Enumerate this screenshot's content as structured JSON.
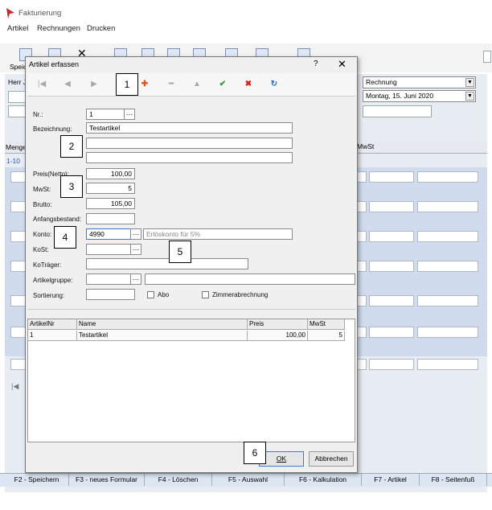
{
  "app": {
    "title": "Fakturierung"
  },
  "menu": [
    "Artikel",
    "Rechnungen",
    "Drucken"
  ],
  "toolbar": {
    "save_partial": "Speic"
  },
  "background": {
    "customer_partial": "Herr J",
    "invoice_type": "Rechnung",
    "date": "Montag, 15. Juni 2020",
    "col_menge": "Menge",
    "col_mwst": "MwSt",
    "range_tab": "1-10"
  },
  "dialog": {
    "title": "Artikel erfassen",
    "help": "?",
    "close": "✕",
    "fields": {
      "nr_label": "Nr.:",
      "nr_value": "1",
      "bez_label": "Bezeichnung:",
      "bez_value": "Testartikel",
      "preis_label": "Preis(Netto):",
      "preis_value": "100,00",
      "mwst_label": "MwSt:",
      "mwst_value": "5",
      "brutto_label": "Brutto:",
      "brutto_value": "105,00",
      "anfang_label": "Anfangsbestand:",
      "konto_label": "Konto:",
      "konto_value": "4990",
      "konto_desc": "Erlöskonto für 5%",
      "kost_label": "KoSt:",
      "kotraeger_label": "KoTräger:",
      "gruppe_label": "Artikelgruppe:",
      "sort_label": "Sortierung:",
      "abo_label": "Abo",
      "zimmer_label": "Zimmerabrechnung"
    },
    "table": {
      "headers": [
        "ArtikelNr",
        "Name",
        "Preis",
        "MwSt"
      ],
      "rows": [
        [
          "1",
          "Testartikel",
          "100,00",
          "5"
        ]
      ]
    },
    "ok": "OK",
    "cancel": "Abbrechen"
  },
  "callouts": [
    "1",
    "2",
    "3",
    "4",
    "5",
    "6"
  ],
  "function_keys": [
    "F2 - Speichern",
    "F3 - neues Formular",
    "F4 - Löschen",
    "F5 - Auswahl",
    "F6 - Kalkulation",
    "F7 - Artikel",
    "F8 - Seitenfuß"
  ],
  "colors": {
    "accent": "#3a7bd5",
    "add": "#e8501a",
    "save": "#2a9d2a",
    "delete": "#d62020",
    "refresh": "#1e6fc8"
  }
}
